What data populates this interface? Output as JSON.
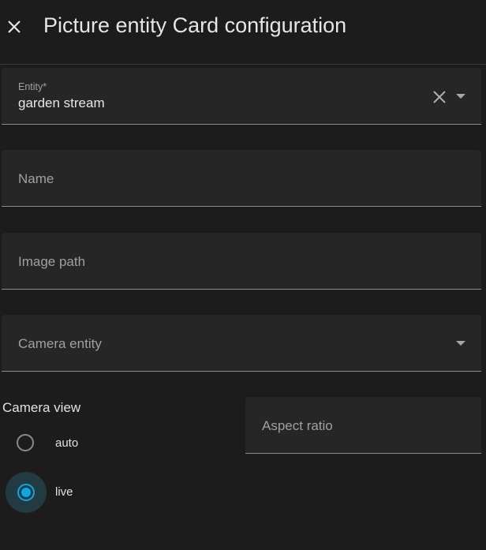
{
  "header": {
    "title": "Picture entity Card configuration",
    "close_icon": "close-icon"
  },
  "fields": {
    "entity": {
      "label": "Entity*",
      "value": "garden stream"
    },
    "name": {
      "placeholder": "Name"
    },
    "image_path": {
      "placeholder": "Image path"
    },
    "camera_entity": {
      "placeholder": "Camera entity"
    },
    "aspect_ratio": {
      "placeholder": "Aspect ratio"
    }
  },
  "camera_view": {
    "label": "Camera view",
    "options": [
      {
        "label": "auto",
        "selected": false
      },
      {
        "label": "live",
        "selected": true
      }
    ]
  },
  "colors": {
    "accent": "#0aa8e8",
    "background": "#1c1c1c",
    "field": "#262626"
  }
}
